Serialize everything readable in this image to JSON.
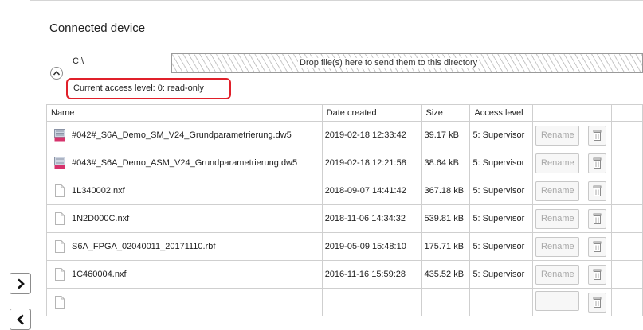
{
  "section": {
    "title": "Connected device",
    "path": "C:\\",
    "drop_text": "Drop file(s) here to send them to this directory",
    "access_label": "Current access level:  0: read-only"
  },
  "table": {
    "headers": {
      "name": "Name",
      "date": "Date created",
      "size": "Size",
      "access": "Access level"
    },
    "rows": [
      {
        "icon": "dw5-file-icon",
        "name": "#042#_S6A_Demo_SM_V24_Grundparametrierung.dw5",
        "date": "2019-02-18 12:33:42",
        "size": "39.17 kB",
        "access": "5: Supervisor",
        "rename": "Rename"
      },
      {
        "icon": "dw5-file-icon",
        "name": "#043#_S6A_Demo_ASM_V24_Grundparametrierung.dw5",
        "date": "2019-02-18 12:21:58",
        "size": "38.64 kB",
        "access": "5: Supervisor",
        "rename": "Rename"
      },
      {
        "icon": "file-icon",
        "name": "1L340002.nxf",
        "date": "2018-09-07 14:41:42",
        "size": "367.18 kB",
        "access": "5: Supervisor",
        "rename": "Rename"
      },
      {
        "icon": "file-icon",
        "name": "1N2D000C.nxf",
        "date": "2018-11-06 14:34:32",
        "size": "539.81 kB",
        "access": "5: Supervisor",
        "rename": "Rename"
      },
      {
        "icon": "file-icon",
        "name": "S6A_FPGA_02040011_20171110.rbf",
        "date": "2019-05-09 15:48:10",
        "size": "175.71 kB",
        "access": "5: Supervisor",
        "rename": "Rename"
      },
      {
        "icon": "file-icon",
        "name": "1C460004.nxf",
        "date": "2016-11-16 15:59:28",
        "size": "435.52 kB",
        "access": "5: Supervisor",
        "rename": "Rename"
      },
      {
        "icon": "file-icon",
        "name": "",
        "date": "",
        "size": "",
        "access": "",
        "rename": ""
      }
    ]
  },
  "nav": {
    "next_icon": "chevron-right-icon",
    "prev_icon": "chevron-left-icon"
  },
  "colors": {
    "highlight_border": "#e0202a",
    "grid_border": "#cfcfcf",
    "disabled_text": "#a8a8a8"
  }
}
